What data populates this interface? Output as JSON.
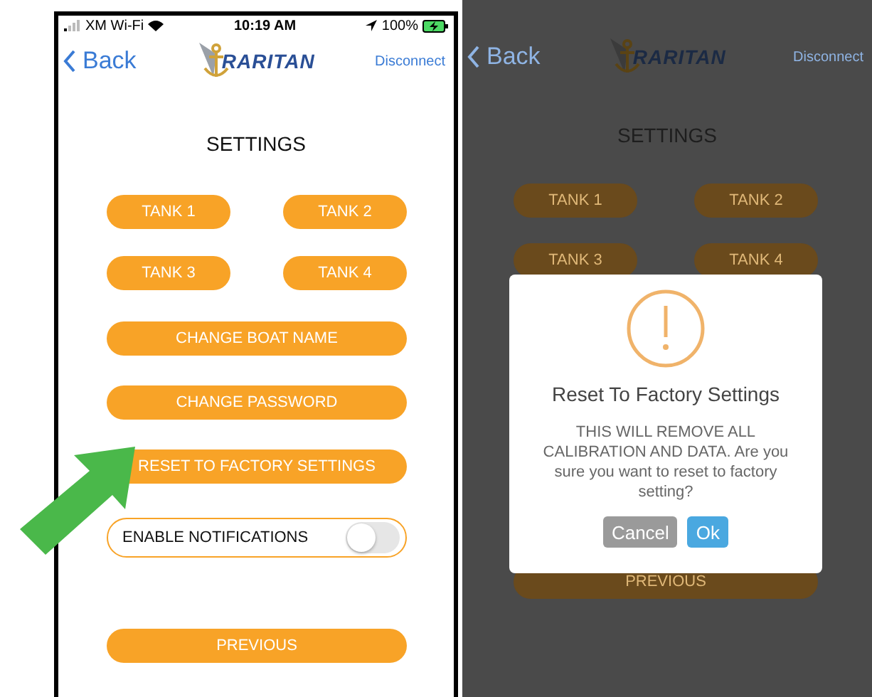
{
  "status_bar": {
    "carrier": "XM Wi-Fi",
    "time": "10:19 AM",
    "battery": "100%",
    "charging": true
  },
  "nav": {
    "back": "Back",
    "logo": "RARITAN",
    "action": "Disconnect"
  },
  "title": "SETTINGS",
  "tank_buttons": [
    "TANK 1",
    "TANK 2",
    "TANK 3",
    "TANK 4"
  ],
  "actions": [
    "CHANGE BOAT NAME",
    "CHANGE PASSWORD",
    "RESET TO FACTORY SETTINGS"
  ],
  "notifications": {
    "label": "ENABLE NOTIFICATIONS",
    "on": false
  },
  "previous": "PREVIOUS",
  "dimmed_screen": {
    "nav": {
      "back": "Back",
      "logo": "RARITAN",
      "action": "Disconnect"
    },
    "title": "SETTINGS",
    "tank_buttons": [
      "TANK 1",
      "TANK 2",
      "TANK 3",
      "TANK 4"
    ],
    "previous": "PREVIOUS"
  },
  "dialog": {
    "title": "Reset To Factory Settings",
    "message": "THIS WILL REMOVE ALL CALIBRATION AND DATA. Are you sure you want to reset to factory setting?",
    "buttons": [
      {
        "label": "Cancel",
        "disabled": true
      },
      {
        "label": "Ok",
        "disabled": false
      }
    ]
  }
}
